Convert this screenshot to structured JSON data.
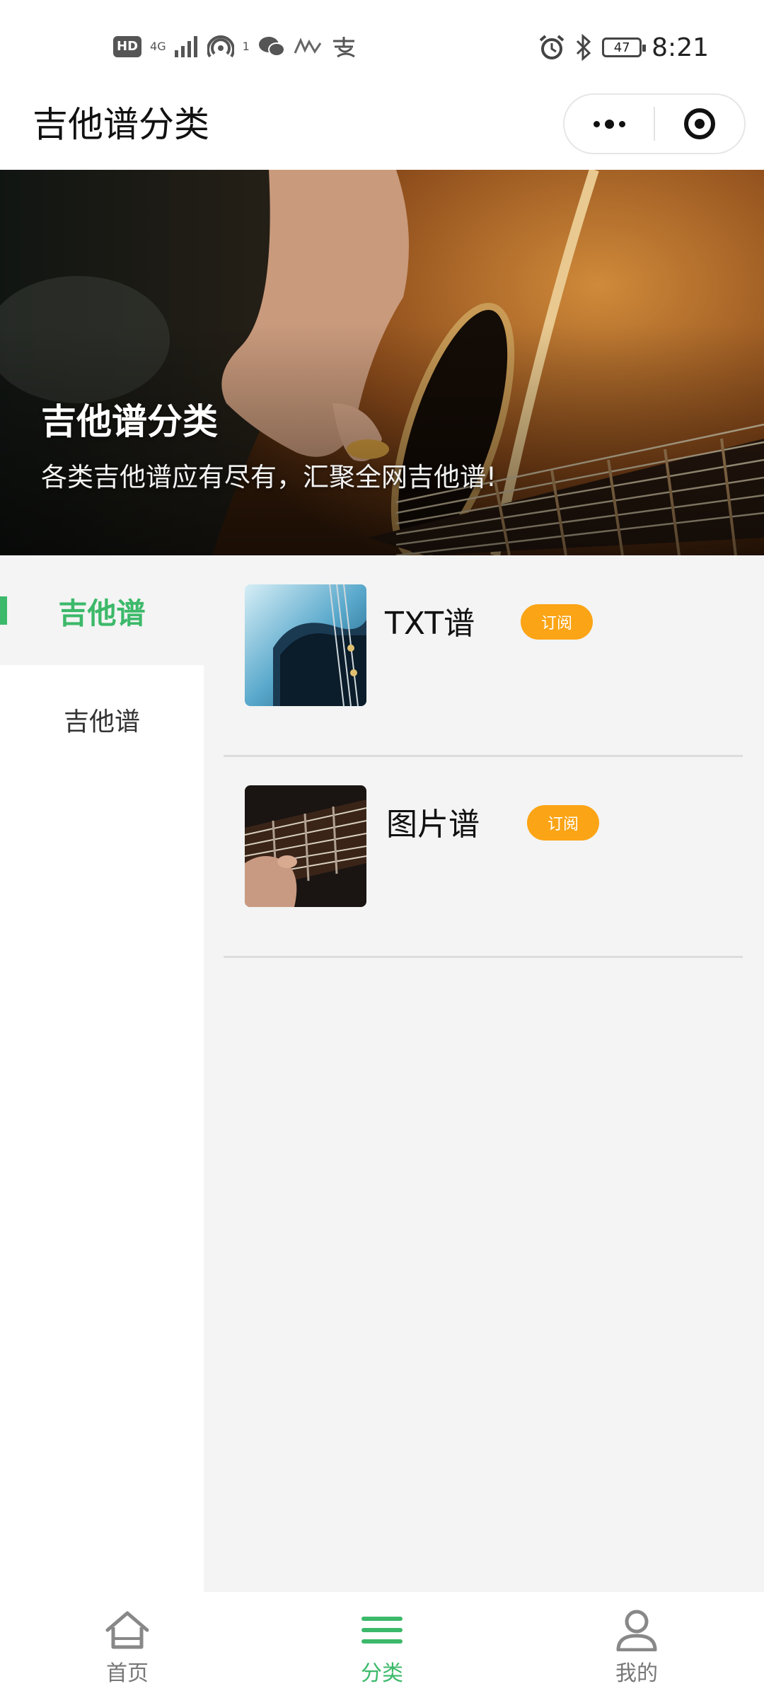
{
  "status_bar": {
    "hd": "HD",
    "network": "4G",
    "hotspot_count": "1",
    "battery": "47",
    "time": "8:21"
  },
  "nav": {
    "title": "吉他谱分类"
  },
  "banner": {
    "title": "吉他谱分类",
    "subtitle": "各类吉他谱应有尽有，汇聚全网吉他谱!"
  },
  "sidebar": {
    "items": [
      {
        "label": "吉他谱",
        "active": true
      },
      {
        "label": "吉他谱",
        "active": false
      }
    ]
  },
  "list": {
    "items": [
      {
        "name": "TXT谱",
        "button": "订阅"
      },
      {
        "name": "图片谱",
        "button": "订阅"
      }
    ]
  },
  "tabbar": {
    "tabs": [
      {
        "label": "首页",
        "icon": "home-icon",
        "active": false
      },
      {
        "label": "分类",
        "icon": "menu-icon",
        "active": true
      },
      {
        "label": "我的",
        "icon": "user-icon",
        "active": false
      }
    ]
  },
  "colors": {
    "accent_green": "#3cb96a",
    "subscribe_orange": "#fba415",
    "panel_bg": "#f3f4f3"
  }
}
